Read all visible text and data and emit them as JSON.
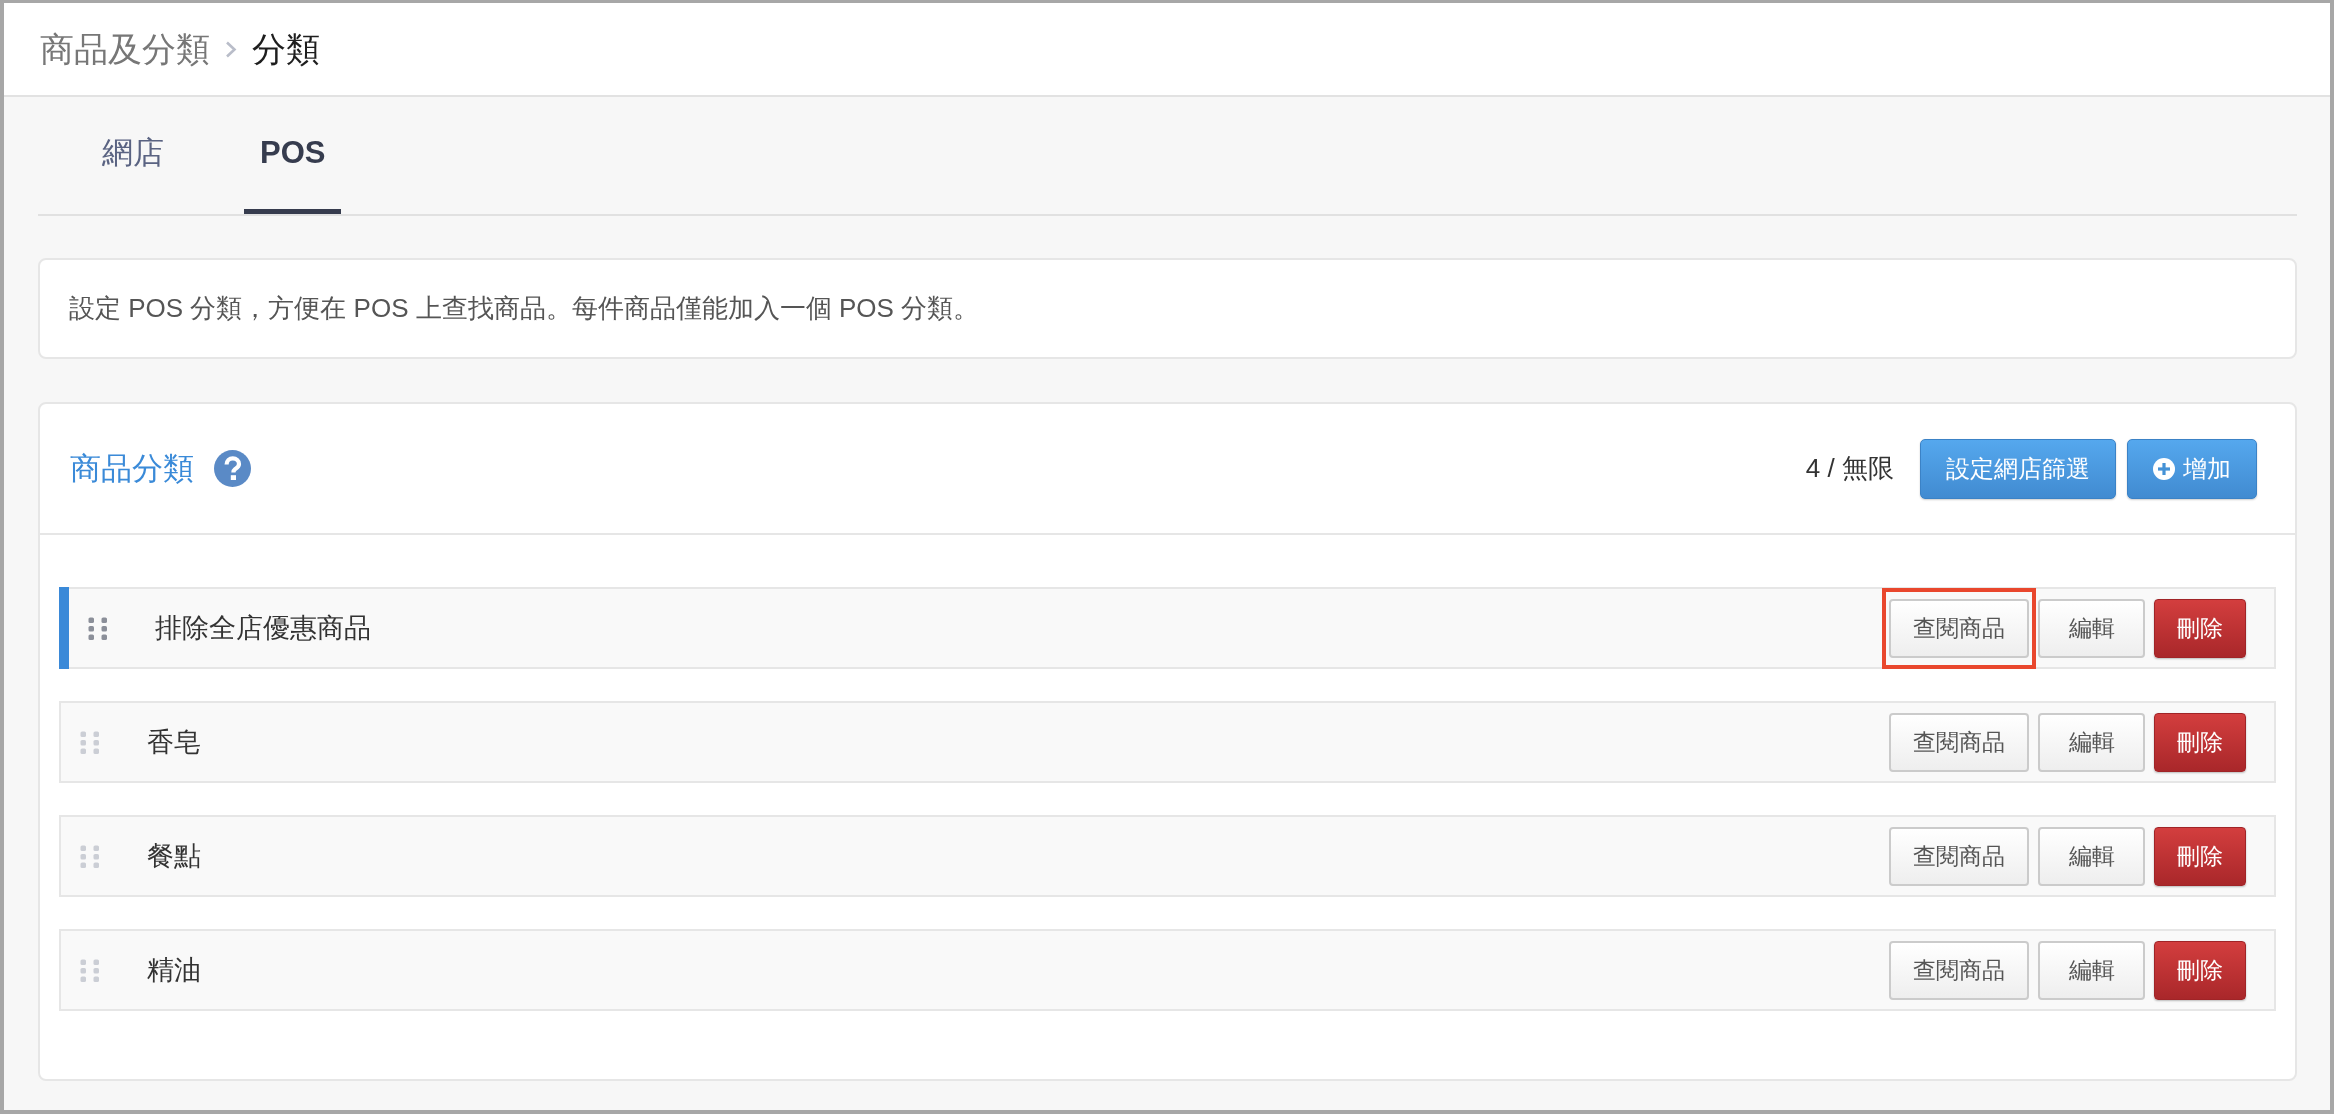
{
  "breadcrumb": [
    {
      "label": "商品及分類",
      "current": false
    },
    {
      "label": "分類",
      "current": true
    }
  ],
  "tabs": [
    {
      "label": "網店",
      "selected": false
    },
    {
      "label": "POS",
      "selected": true
    }
  ],
  "notice": "設定 POS 分類，方便在 POS 上查找商品。每件商品僅能加入一個 POS 分類。",
  "panel": {
    "title": "商品分類",
    "count": "4 / 無限",
    "buttons": [
      {
        "label": "設定網店篩選",
        "kind": "filter"
      },
      {
        "label": "增加",
        "kind": "add"
      }
    ],
    "rows": [
      {
        "name": "排除全店優惠商品",
        "selected": true,
        "actions": [
          {
            "label": "查閱商品",
            "kind": "view",
            "highlighted": true
          },
          {
            "label": "編輯",
            "kind": "edit",
            "highlighted": false
          },
          {
            "label": "刪除",
            "kind": "delete",
            "highlighted": false
          }
        ]
      },
      {
        "name": "香皂",
        "selected": false,
        "actions": [
          {
            "label": "查閱商品",
            "kind": "view",
            "highlighted": false
          },
          {
            "label": "編輯",
            "kind": "edit",
            "highlighted": false
          },
          {
            "label": "刪除",
            "kind": "delete",
            "highlighted": false
          }
        ]
      },
      {
        "name": "餐點",
        "selected": false,
        "actions": [
          {
            "label": "查閱商品",
            "kind": "view",
            "highlighted": false
          },
          {
            "label": "編輯",
            "kind": "edit",
            "highlighted": false
          },
          {
            "label": "刪除",
            "kind": "delete",
            "highlighted": false
          }
        ]
      },
      {
        "name": "精油",
        "selected": false,
        "actions": [
          {
            "label": "查閱商品",
            "kind": "view",
            "highlighted": false
          },
          {
            "label": "編輯",
            "kind": "edit",
            "highlighted": false
          },
          {
            "label": "刪除",
            "kind": "delete",
            "highlighted": false
          }
        ]
      }
    ]
  }
}
